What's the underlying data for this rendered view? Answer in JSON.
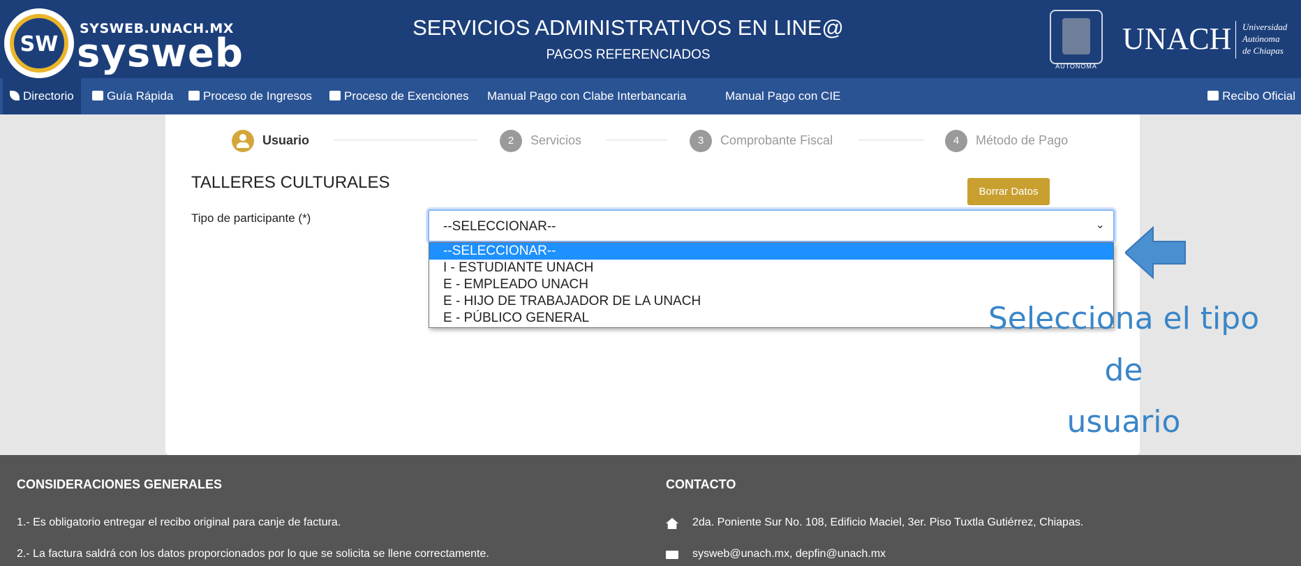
{
  "header": {
    "logo_url_text": "SYSWEB.UNACH.MX",
    "logo_name": "sysweb",
    "logo_badge": "SW",
    "title": "SERVICIOS ADMINISTRATIVOS EN LINE@",
    "subtitle": "PAGOS REFERENCIADOS",
    "university_acronym": "UNACH",
    "university_seal_label": "AUTONOMA",
    "university_line1": "Universidad",
    "university_line2": "Autónoma",
    "university_line3": "de Chiapas"
  },
  "nav": {
    "items": [
      {
        "label": "Directorio",
        "icon": "phone-icon"
      },
      {
        "label": "Guía Rápida",
        "icon": "book-icon"
      },
      {
        "label": "Proceso de Ingresos",
        "icon": "document-icon"
      },
      {
        "label": "Proceso de Exenciones",
        "icon": "document-icon"
      },
      {
        "label": "Manual Pago con Clabe Interbancaria",
        "icon": "id-card-icon"
      },
      {
        "label": "Manual Pago con CIE",
        "icon": "id-card-icon"
      }
    ],
    "right_item": {
      "label": "Recibo Oficial",
      "icon": "document-icon"
    }
  },
  "stepper": {
    "steps": [
      {
        "number": "",
        "label": "Usuario",
        "active": true
      },
      {
        "number": "2",
        "label": "Servicios",
        "active": false
      },
      {
        "number": "3",
        "label": "Comprobante Fiscal",
        "active": false
      },
      {
        "number": "4",
        "label": "Método de Pago",
        "active": false
      }
    ]
  },
  "form": {
    "section_title": "TALLERES CULTURALES",
    "clear_button": "Borrar Datos",
    "participant_label": "Tipo de participante (*)",
    "participant_value": "--SELECCIONAR--",
    "options": [
      "--SELECCIONAR--",
      "I - ESTUDIANTE UNACH",
      "E - EMPLEADO UNACH",
      "E - HIJO DE TRABAJADOR DE LA UNACH",
      "E - PÚBLICO GENERAL"
    ]
  },
  "annotation": {
    "line1": "Selecciona el tipo de",
    "line2": "usuario",
    "color": "#3a86c8"
  },
  "footer": {
    "considerations_title": "CONSIDERACIONES GENERALES",
    "consideration_1": "1.- Es obligatorio entregar el recibo original para canje de factura.",
    "consideration_2": "2.- La factura saldrá con los datos proporcionados por lo que se solicita se llene correctamente.",
    "contact_title": "CONTACTO",
    "contact_address": "2da. Poniente Sur No. 108, Edificio Maciel, 3er. Piso Tuxtla Gutiérrez, Chiapas.",
    "contact_email": "sysweb@unach.mx, depfin@unach.mx"
  },
  "colors": {
    "header_bg": "#1c3f7a",
    "nav_bg": "#2a5394",
    "accent_gold": "#c9a030",
    "selected_option": "#1e90ff",
    "footer_bg": "#555555"
  }
}
